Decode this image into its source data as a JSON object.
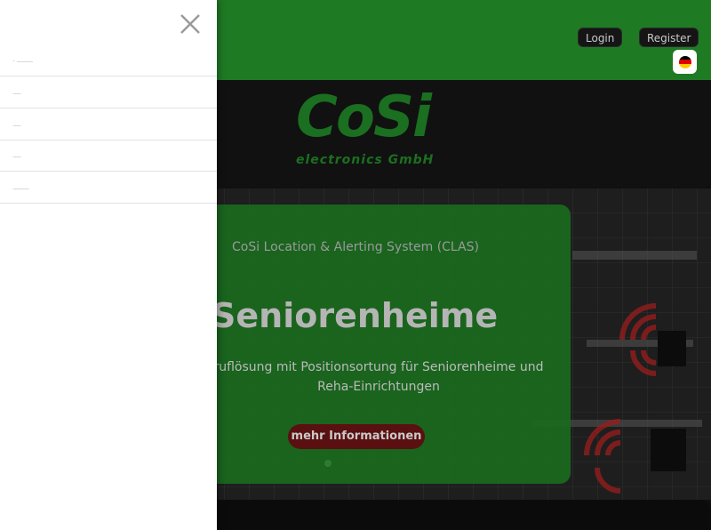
{
  "header": {
    "login_label": "Login",
    "register_label": "Register",
    "language_flag": "german-flag-icon"
  },
  "logo": {
    "mark": "CoSi",
    "sub": "electronics GmbH"
  },
  "hero": {
    "kicker": "CoSi Location & Alerting System (CLAS)",
    "title": "Seniorenheime",
    "text": "ruflösung mit Positionsortung für Seniorenheime und Reha-Einrichtungen",
    "cta_label": "mehr Informationen"
  },
  "drawer": {
    "close_icon": "close-icon",
    "items": [
      {
        "label": "· ——"
      },
      {
        "label": "—"
      },
      {
        "label": "—"
      },
      {
        "label": "—"
      },
      {
        "label": "——"
      }
    ]
  },
  "colors": {
    "brand_green": "#1f7a24",
    "overlay_green": "#1a6a1e",
    "cta_red": "#5a1010",
    "drawer_bg": "#ffffff"
  }
}
